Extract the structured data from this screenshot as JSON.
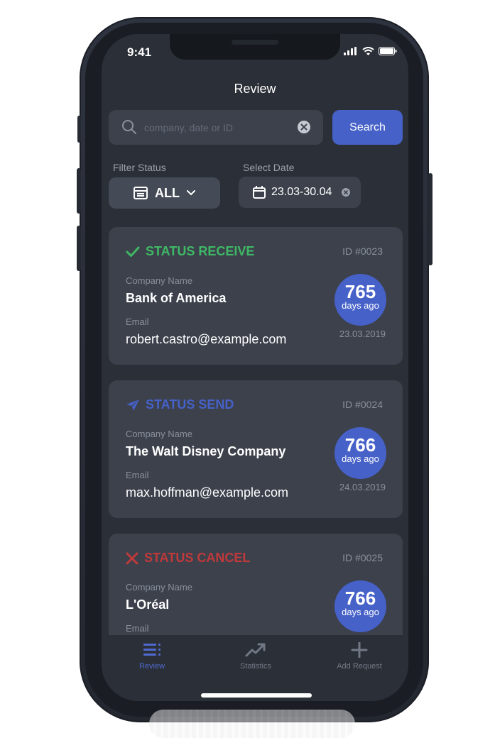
{
  "status_bar": {
    "time": "9:41"
  },
  "header": {
    "title": "Review"
  },
  "search": {
    "placeholder": "company, date or ID",
    "button_label": "Search"
  },
  "filters": {
    "status_label": "Filter Status",
    "status_value": "ALL",
    "date_label": "Select Date",
    "date_value": "23.03-30.04"
  },
  "cards": [
    {
      "status": "STATUS RECEIVE",
      "status_color": "#3fb865",
      "status_icon": "check-icon",
      "id": "ID #0023",
      "company_label": "Company Name",
      "company": "Bank of America",
      "email_label": "Email",
      "email": "robert.castro@example.com",
      "days": "765",
      "days_label": "days ago",
      "date": "23.03.2019"
    },
    {
      "status": "STATUS SEND",
      "status_color": "#4661c8",
      "status_icon": "send-icon",
      "id": "ID #0024",
      "company_label": "Company Name",
      "company": "The Walt Disney Company",
      "email_label": "Email",
      "email": "max.hoffman@example.com",
      "days": "766",
      "days_label": "days ago",
      "date": "24.03.2019"
    },
    {
      "status": "STATUS CANCEL",
      "status_color": "#c0393b",
      "status_icon": "x-icon",
      "id": "ID #0025",
      "company_label": "Company Name",
      "company": "L'Oréal",
      "email_label": "Email",
      "days": "766",
      "days_label": "days ago"
    }
  ],
  "tabbar": {
    "items": [
      {
        "label": "Review",
        "icon": "list-icon",
        "active": true
      },
      {
        "label": "Statistics",
        "icon": "trend-icon",
        "active": false
      },
      {
        "label": "Add Request",
        "icon": "plus-icon",
        "active": false
      }
    ]
  },
  "colors": {
    "accent": "#4661c8",
    "background": "#2b2f37",
    "card": "#3c414c"
  }
}
